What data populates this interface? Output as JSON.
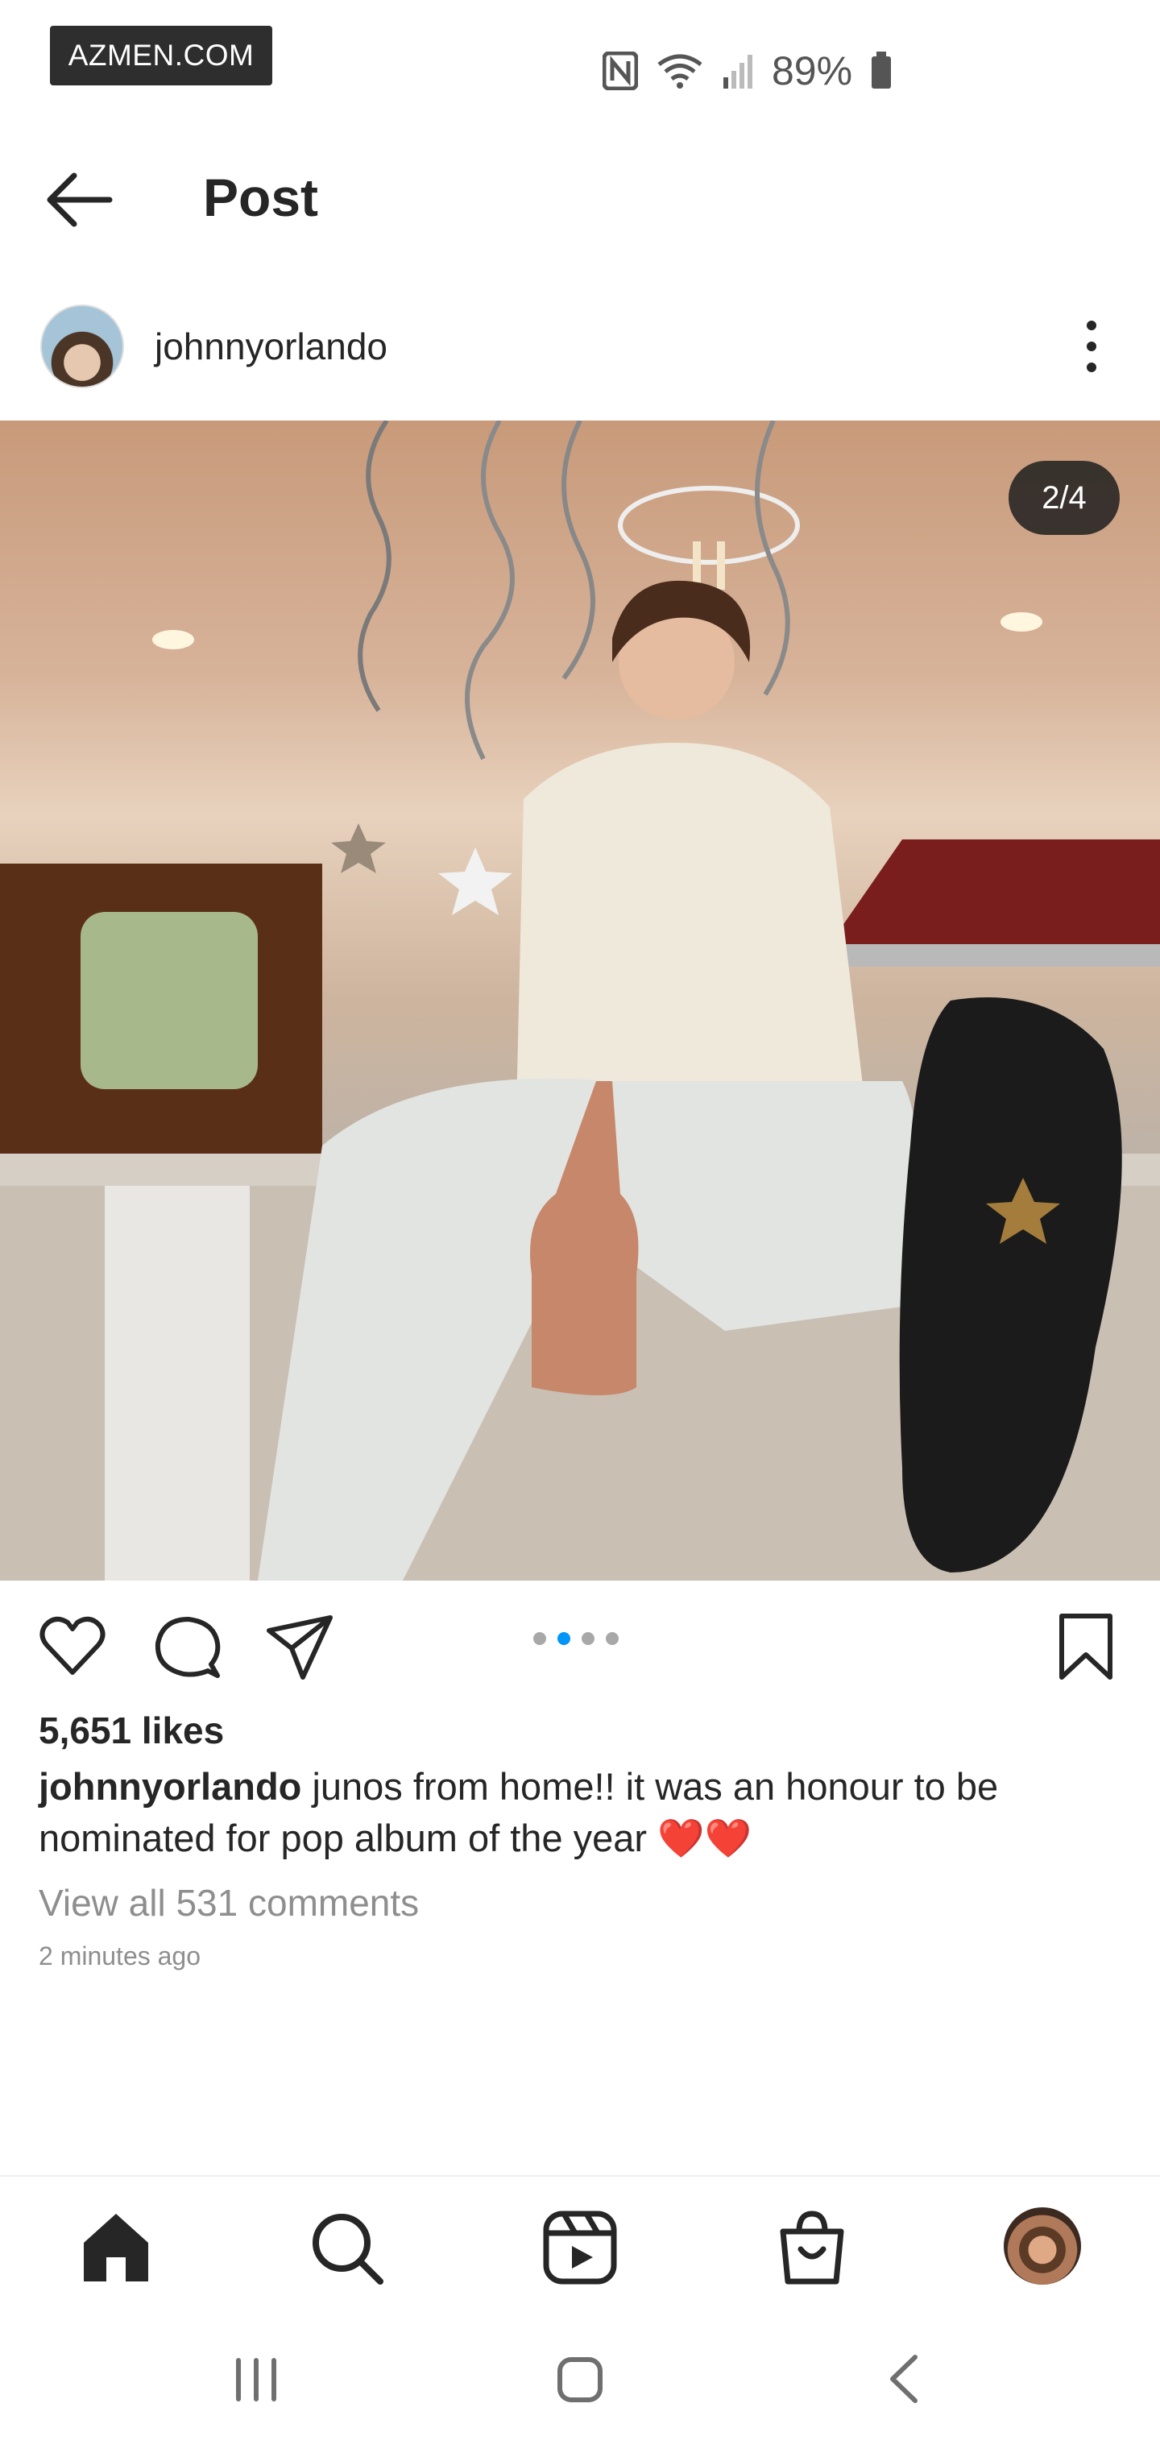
{
  "watermark": "AZMEN.COM",
  "status_bar": {
    "battery": "89%",
    "icons": [
      "nfc-icon",
      "wifi-icon",
      "signal-icon",
      "battery-icon"
    ]
  },
  "header": {
    "title": "Post"
  },
  "post": {
    "username": "johnnyorlando",
    "media_counter": "2/4",
    "carousel": {
      "total": 4,
      "active_index": 1
    },
    "likes": "5,651 likes",
    "caption_user": "johnnyorlando",
    "caption_text": "junos from home!! it was an honour to be nominated for pop album of the year ❤️❤️",
    "view_comments": "View all 531 comments",
    "timestamp": "2 minutes ago"
  },
  "bottom_nav": {
    "items": [
      "home-icon",
      "search-icon",
      "reels-icon",
      "shop-icon",
      "profile-avatar"
    ],
    "active": "home-icon"
  },
  "system_nav": [
    "recents-icon",
    "home-button-icon",
    "back-icon"
  ],
  "colors": {
    "accent": "#0095f6",
    "text": "#262626",
    "muted": "#8e8e8e",
    "like_heart": "#ed4956"
  }
}
